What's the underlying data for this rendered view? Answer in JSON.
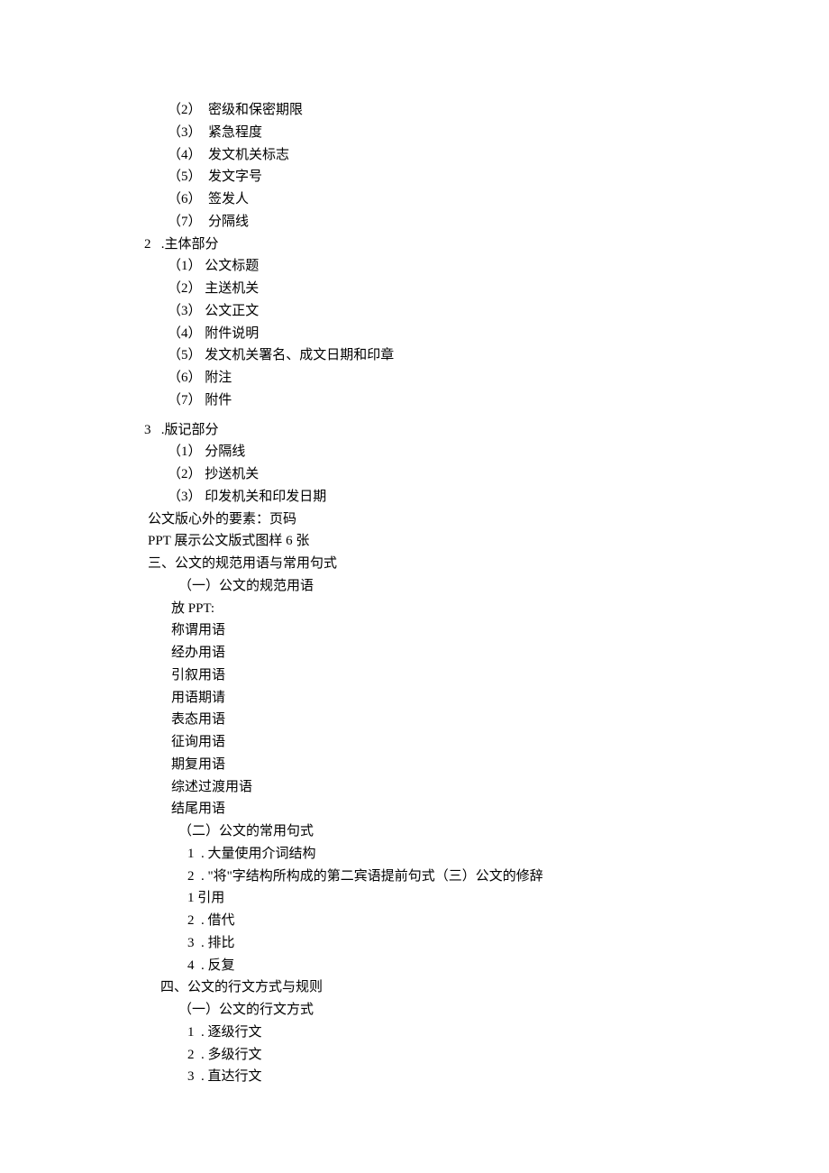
{
  "lines": [
    {
      "cls": "indent-2",
      "text": "（2）  密级和保密期限"
    },
    {
      "cls": "indent-2",
      "text": "（3）  紧急程度"
    },
    {
      "cls": "indent-2",
      "text": "（4）  发文机关标志"
    },
    {
      "cls": "indent-2",
      "text": "（5）  发文字号"
    },
    {
      "cls": "indent-2",
      "text": "（6）  签发人"
    },
    {
      "cls": "indent-2",
      "text": "（7）  分隔线"
    },
    {
      "cls": "num-indent",
      "text": "2   .主体部分"
    },
    {
      "cls": "indent-2",
      "text": "（1） 公文标题"
    },
    {
      "cls": "indent-2",
      "text": "（2） 主送机关"
    },
    {
      "cls": "indent-2",
      "text": "（3） 公文正文"
    },
    {
      "cls": "indent-2",
      "text": "（4） 附件说明"
    },
    {
      "cls": "indent-2",
      "text": "（5） 发文机关署名、成文日期和印章"
    },
    {
      "cls": "indent-2",
      "text": "（6） 附注"
    },
    {
      "cls": "indent-2",
      "text": "（7） 附件"
    },
    {
      "cls": "num-indent gap-top",
      "text": "3   .版记部分"
    },
    {
      "cls": "indent-2",
      "text": "（1） 分隔线"
    },
    {
      "cls": "indent-2",
      "text": "（2） 抄送机关"
    },
    {
      "cls": "indent-2",
      "text": "（3） 印发机关和印发日期"
    },
    {
      "cls": "indent-1b",
      "text": "公文版心外的要素：页码"
    },
    {
      "cls": "indent-1b",
      "text": "PPT 展示公文版式图样 6 张"
    },
    {
      "cls": "indent-1b",
      "text": "三、公文的规范用语与常用句式"
    },
    {
      "cls": "indent-3",
      "text": "（一）公文的规范用语"
    },
    {
      "cls": "indent-2b",
      "text": "放 PPT:"
    },
    {
      "cls": "indent-2b",
      "text": "称谓用语"
    },
    {
      "cls": "indent-2b",
      "text": "经办用语"
    },
    {
      "cls": "indent-2b",
      "text": "引叙用语"
    },
    {
      "cls": "indent-2b",
      "text": "用语期请"
    },
    {
      "cls": "indent-2b",
      "text": "表态用语"
    },
    {
      "cls": "indent-2b",
      "text": "征询用语"
    },
    {
      "cls": "indent-2b",
      "text": "期复用语"
    },
    {
      "cls": "indent-2b",
      "text": "综述过渡用语"
    },
    {
      "cls": "indent-2b",
      "text": "结尾用语"
    },
    {
      "cls": "indent-3",
      "text": "（二）公文的常用句式"
    },
    {
      "cls": "indent-4",
      "text": "1  . 大量使用介词结构"
    },
    {
      "cls": "indent-4",
      "text": "2  . \"将\"字结构所构成的第二宾语提前句式（三）公文的修辞"
    },
    {
      "cls": "indent-4",
      "text": "1 引用"
    },
    {
      "cls": "indent-4",
      "text": "2  . 借代"
    },
    {
      "cls": "indent-4",
      "text": "3  . 排比"
    },
    {
      "cls": "indent-4",
      "text": "4  . 反复"
    },
    {
      "cls": "indent-5",
      "text": "四、公文的行文方式与规则"
    },
    {
      "cls": "indent-3",
      "text": "（一）公文的行文方式"
    },
    {
      "cls": "indent-4",
      "text": "1  . 逐级行文"
    },
    {
      "cls": "indent-4",
      "text": "2  . 多级行文"
    },
    {
      "cls": "indent-4",
      "text": "3  . 直达行文"
    }
  ]
}
